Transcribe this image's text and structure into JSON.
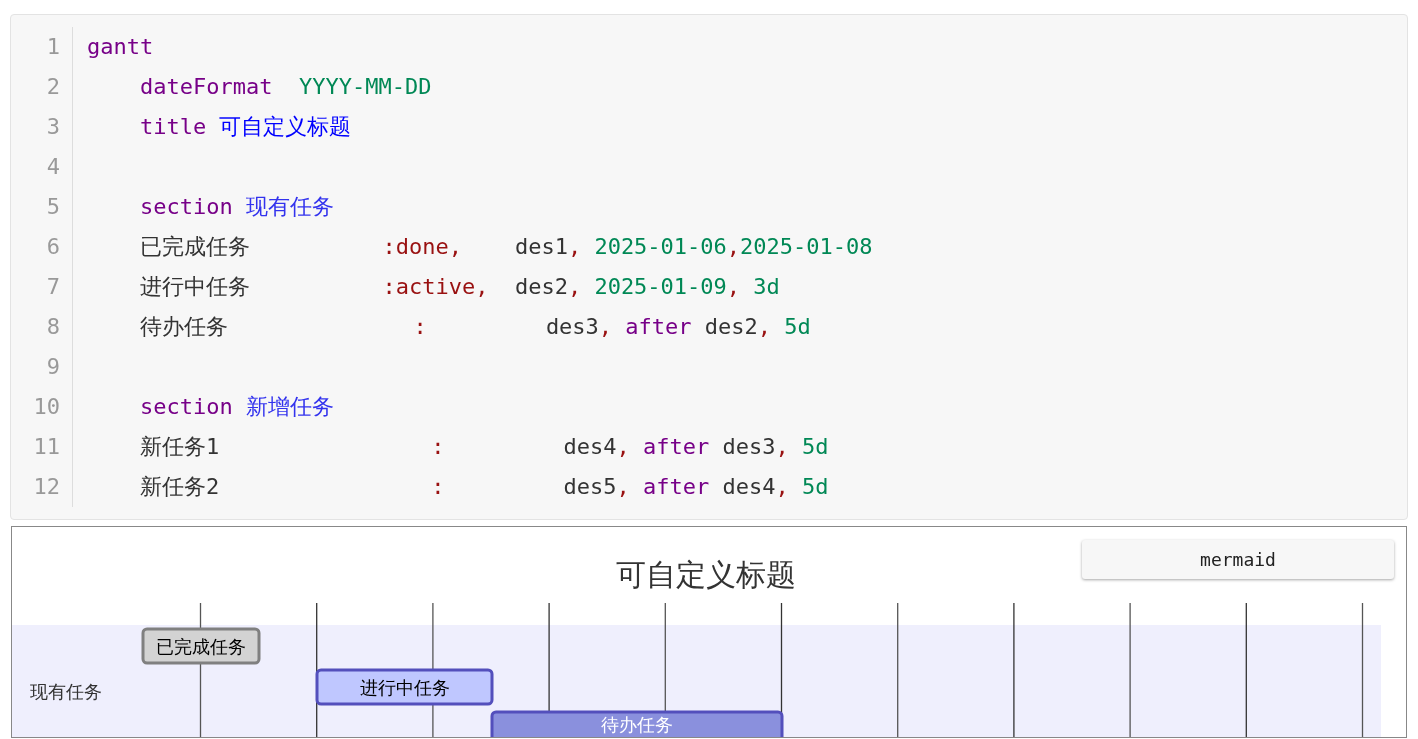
{
  "editor": {
    "lines": [
      {
        "number": "1",
        "tokens": [
          {
            "kind": "kw",
            "text": "gantt"
          }
        ]
      },
      {
        "number": "2",
        "tokens": [
          {
            "kind": "kw",
            "text": "    dateFormat"
          },
          {
            "kind": "str",
            "text": "  YYYY-MM-DD"
          }
        ]
      },
      {
        "number": "3",
        "tokens": [
          {
            "kind": "kw",
            "text": "    title"
          },
          {
            "kind": "def",
            "text": " 可自定义标题"
          }
        ]
      },
      {
        "number": "4"
      },
      {
        "number": "5",
        "tokens": [
          {
            "kind": "kw",
            "text": "    section"
          },
          {
            "kind": "sec",
            "text": " 现有任务"
          }
        ]
      },
      {
        "number": "6",
        "tokens": [
          {
            "kind": "plain",
            "text": "    已完成任务          "
          },
          {
            "kind": "punct",
            "text": ":done,"
          },
          {
            "kind": "plain",
            "text": "    des1"
          },
          {
            "kind": "punct",
            "text": ","
          },
          {
            "kind": "str",
            "text": " 2025-01-06"
          },
          {
            "kind": "punct",
            "text": ","
          },
          {
            "kind": "str",
            "text": "2025-01-08"
          }
        ]
      },
      {
        "number": "7",
        "tokens": [
          {
            "kind": "plain",
            "text": "    进行中任务          "
          },
          {
            "kind": "punct",
            "text": ":active,"
          },
          {
            "kind": "plain",
            "text": "  des2"
          },
          {
            "kind": "punct",
            "text": ","
          },
          {
            "kind": "str",
            "text": " 2025-01-09"
          },
          {
            "kind": "punct",
            "text": ","
          },
          {
            "kind": "str",
            "text": " 3d"
          }
        ]
      },
      {
        "number": "8",
        "tokens": [
          {
            "kind": "plain",
            "text": "    待办任务              "
          },
          {
            "kind": "punct",
            "text": ":"
          },
          {
            "kind": "plain",
            "text": "         des3"
          },
          {
            "kind": "punct",
            "text": ","
          },
          {
            "kind": "kw",
            "text": " after"
          },
          {
            "kind": "plain",
            "text": " des2"
          },
          {
            "kind": "punct",
            "text": ","
          },
          {
            "kind": "str",
            "text": " 5d"
          }
        ]
      },
      {
        "number": "9"
      },
      {
        "number": "10",
        "tokens": [
          {
            "kind": "kw",
            "text": "    section"
          },
          {
            "kind": "sec",
            "text": " 新增任务"
          }
        ]
      },
      {
        "number": "11",
        "tokens": [
          {
            "kind": "plain",
            "text": "    新任务1                "
          },
          {
            "kind": "punct",
            "text": ":"
          },
          {
            "kind": "plain",
            "text": "         des4"
          },
          {
            "kind": "punct",
            "text": ","
          },
          {
            "kind": "kw",
            "text": " after"
          },
          {
            "kind": "plain",
            "text": " des3"
          },
          {
            "kind": "punct",
            "text": ","
          },
          {
            "kind": "str",
            "text": " 5d"
          }
        ]
      },
      {
        "number": "12",
        "tokens": [
          {
            "kind": "plain",
            "text": "    新任务2                "
          },
          {
            "kind": "punct",
            "text": ":"
          },
          {
            "kind": "plain",
            "text": "         des5"
          },
          {
            "kind": "punct",
            "text": ","
          },
          {
            "kind": "kw",
            "text": " after"
          },
          {
            "kind": "plain",
            "text": " des4"
          },
          {
            "kind": "punct",
            "text": ","
          },
          {
            "kind": "str",
            "text": " 5d"
          }
        ]
      }
    ]
  },
  "diagram": {
    "title": "可自定义标题",
    "badge": "mermaid",
    "sections": [
      {
        "label": "现有任务"
      }
    ],
    "tasks": [
      {
        "label": "已完成任务",
        "kind": "done"
      },
      {
        "label": "进行中任务",
        "kind": "active"
      },
      {
        "label": "待办任务",
        "kind": "pending"
      }
    ]
  }
}
